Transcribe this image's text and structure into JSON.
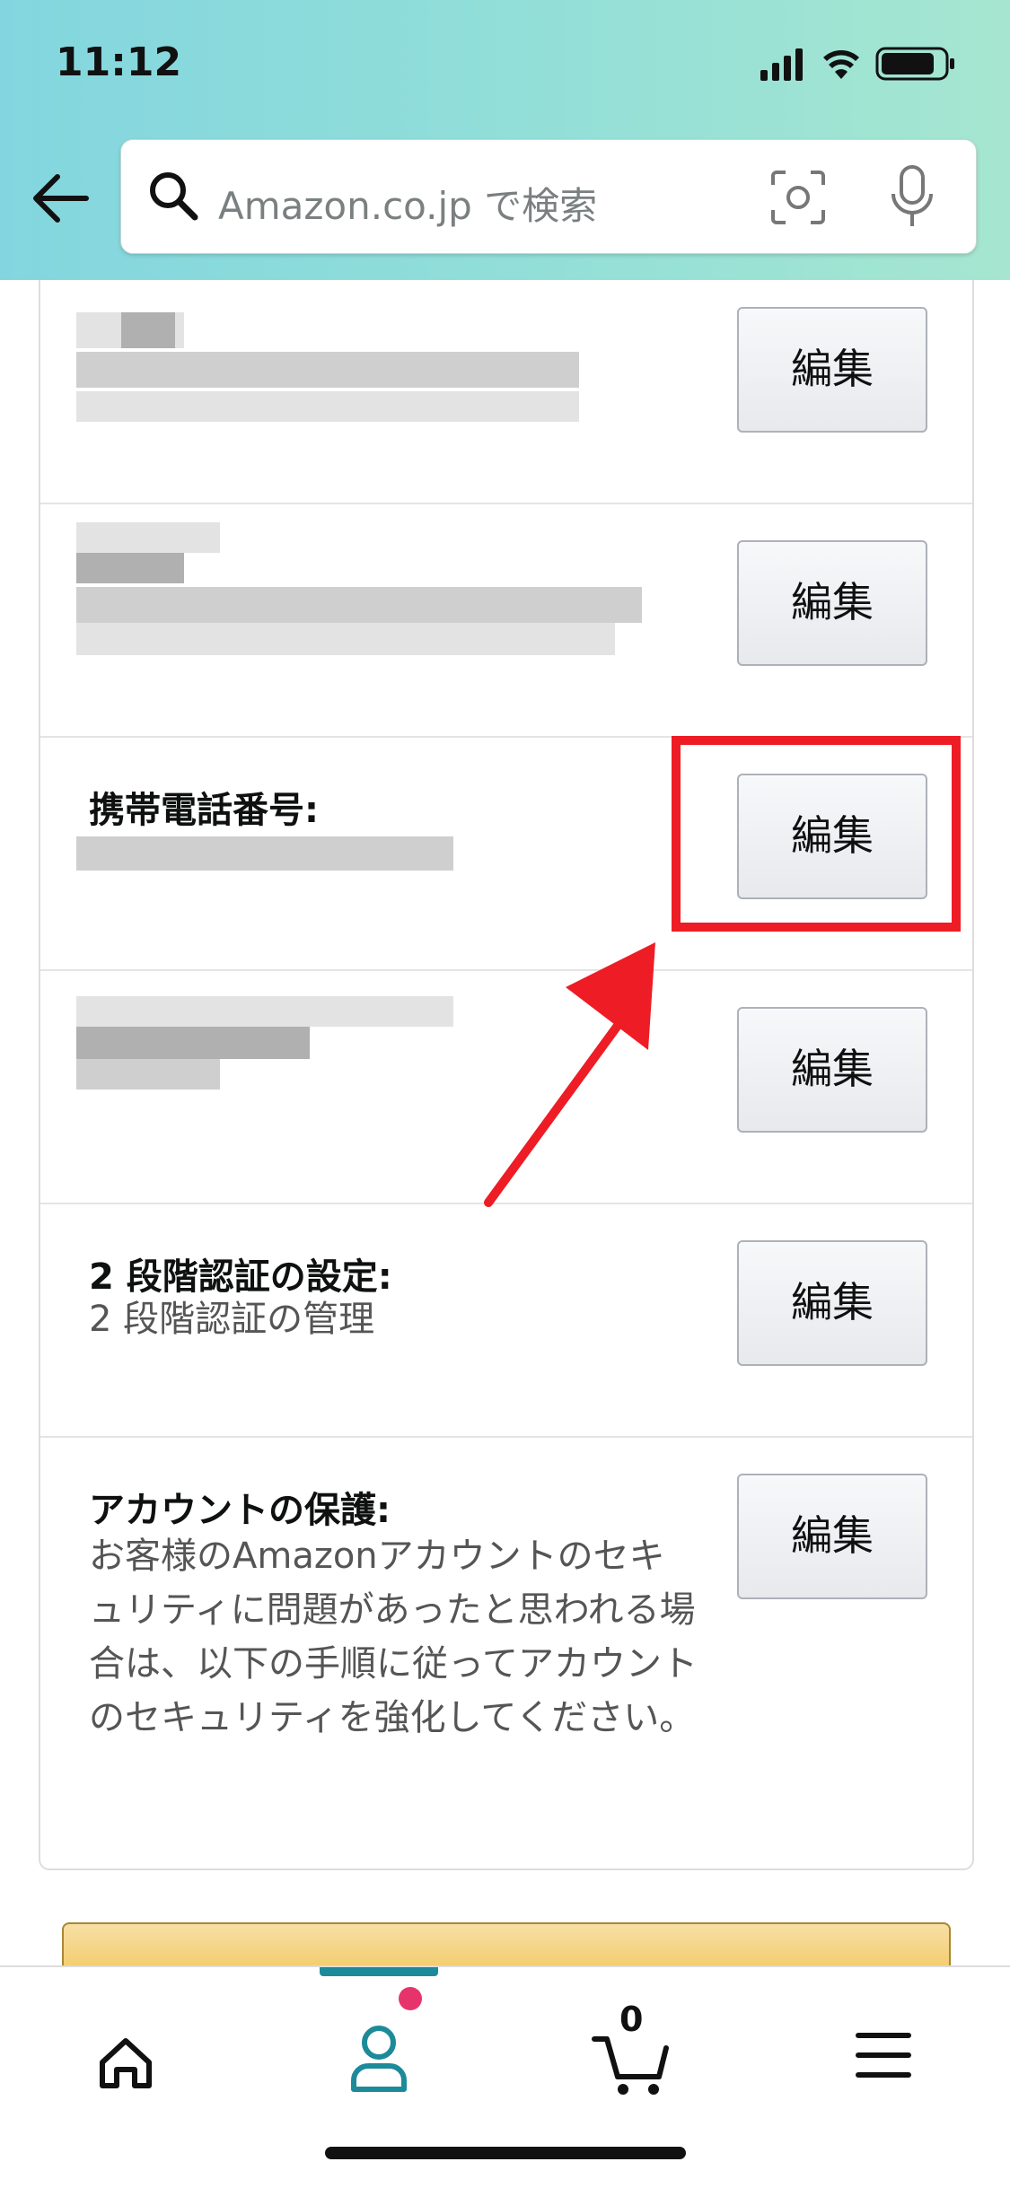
{
  "status_bar": {
    "time": "11:12"
  },
  "search": {
    "placeholder": "Amazon.co.jp で検索"
  },
  "rows": [
    {
      "label": "",
      "value": "",
      "edit": "編集"
    },
    {
      "label": "",
      "value": "",
      "edit": "編集"
    },
    {
      "label": "携帯電話番号:",
      "value": "",
      "edit": "編集"
    },
    {
      "label": "",
      "value": "",
      "edit": "編集"
    },
    {
      "label": "2 段階認証の設定:",
      "value": "2 段階認証の管理",
      "edit": "編集"
    },
    {
      "label": "アカウントの保護:",
      "value": "お客様のAmazonアカウントのセキュリティに問題があったと思われる場合は、以下の手順に従ってアカウントのセキュリティを強化してください。",
      "edit": "編集"
    }
  ],
  "tabbar": {
    "cart_count": "0",
    "items": [
      "home-icon",
      "account-icon",
      "cart-icon",
      "menu-icon"
    ],
    "active_index": 1
  },
  "colors": {
    "header_start": "#83d6df",
    "header_end": "#a6e6d0",
    "annotation_red": "#ee1c24",
    "accent_teal": "#1d8a99",
    "badge_pink": "#e7336c",
    "button_yellow": "#f0c14b"
  }
}
